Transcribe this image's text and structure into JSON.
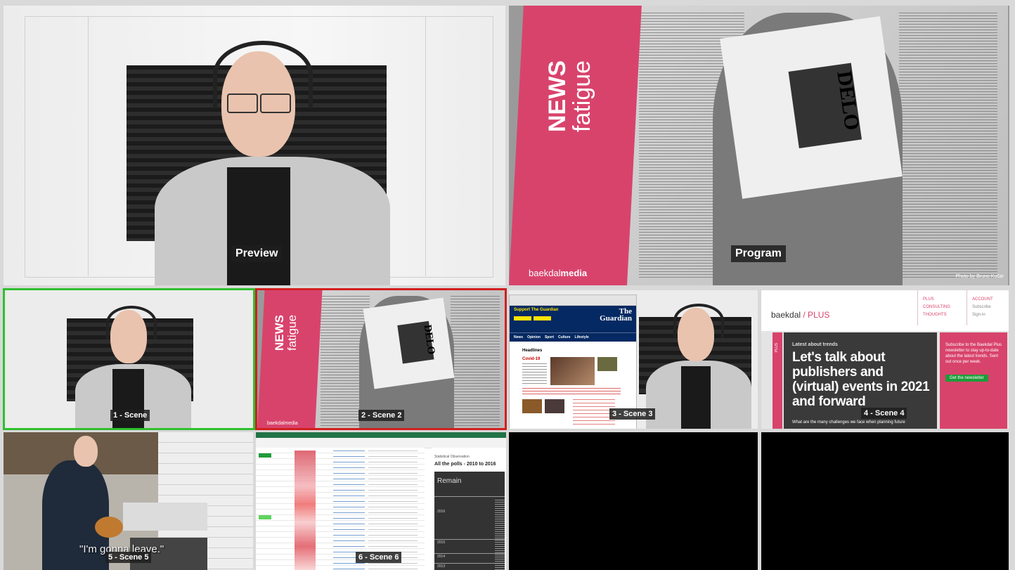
{
  "preview": {
    "label": "Preview"
  },
  "program": {
    "label": "Program",
    "news_word": "NEWS",
    "fatigue_word": "fatigue",
    "brand_prefix": "baekdal",
    "brand_suffix": "media",
    "photo_credit": "Photo by Bruno Kučar",
    "newspaper_title": "DELO"
  },
  "scenes": [
    {
      "label": "1 - Scene",
      "state": "preview"
    },
    {
      "label": "2 - Scene 2",
      "state": "program"
    },
    {
      "label": "3 - Scene 3",
      "state": "idle"
    },
    {
      "label": "4 - Scene 4",
      "state": "idle"
    },
    {
      "label": "5 - Scene 5",
      "state": "idle"
    },
    {
      "label": "6 - Scene 6",
      "state": "idle"
    }
  ],
  "scene2": {
    "news_word": "NEWS",
    "fatigue_word": "fatigue",
    "brand": "baekdalmedia",
    "newspaper_title": "DELO"
  },
  "scene3": {
    "banner_title": "Support The Guardian",
    "logo_line1": "The",
    "logo_line2": "Guardian",
    "nav": [
      "News",
      "Opinion",
      "Sport",
      "Culture",
      "Lifestyle"
    ],
    "headlines_heading": "Headlines",
    "headline_lead": "Covid-19"
  },
  "scene4": {
    "logo_left": "baekdal",
    "logo_right": "/ PLUS",
    "nav_col1": [
      "PLUS",
      "CONSULTING",
      "THOUGHTS"
    ],
    "nav_col2": [
      "ACCOUNT",
      "Subscribe",
      "Sign-in"
    ],
    "kicker": "Latest about trends",
    "headline": "Let's talk about publishers and (virtual) events in 2021 and forward",
    "subhead": "What are the many challenges we face when planning future",
    "side_text": "Subscribe to the Baekdal Plus newsletter to stay up-to-date about the latest trends. Sent out once per week.",
    "side_button": "Get the newsletter",
    "vertical_tag": "PLUS"
  },
  "scene5": {
    "subtitle": "\"I'm gonna leave.\""
  },
  "scene6": {
    "chart_subtitle": "Statistical Observation",
    "chart_title": "All the polls - 2010 to 2016",
    "remain_label": "Remain",
    "year_labels": [
      "2016",
      "2015",
      "2014",
      "2013"
    ]
  },
  "colors": {
    "preview_border": "#2fbf2f",
    "program_border": "#d11f1f",
    "brand_pink": "#d8436c"
  }
}
